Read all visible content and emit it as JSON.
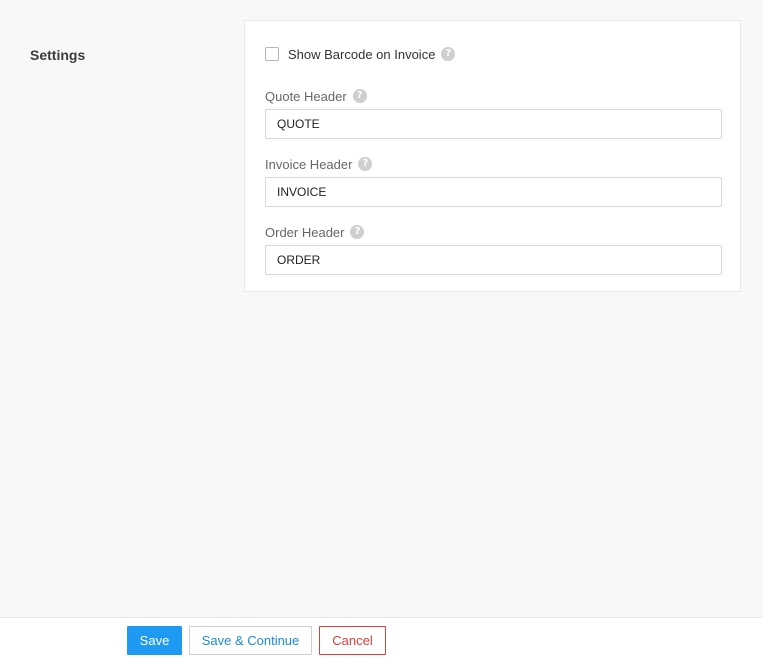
{
  "section": {
    "title": "Settings"
  },
  "settings": {
    "barcode": {
      "label": "Show Barcode on Invoice",
      "checked": false,
      "help_icon": "question-circle-icon"
    },
    "fields": [
      {
        "label": "Quote Header",
        "value": "QUOTE",
        "help_icon": "question-circle-icon"
      },
      {
        "label": "Invoice Header",
        "value": "INVOICE",
        "help_icon": "question-circle-icon"
      },
      {
        "label": "Order Header",
        "value": "ORDER",
        "help_icon": "question-circle-icon"
      }
    ],
    "help_glyph": "?"
  },
  "footer": {
    "save_label": "Save",
    "save_continue_label": "Save & Continue",
    "cancel_label": "Cancel"
  },
  "colors": {
    "primary": "#1e9af3",
    "link": "#1e88d8",
    "danger": "#d9413a",
    "background": "#f8f8f8"
  }
}
